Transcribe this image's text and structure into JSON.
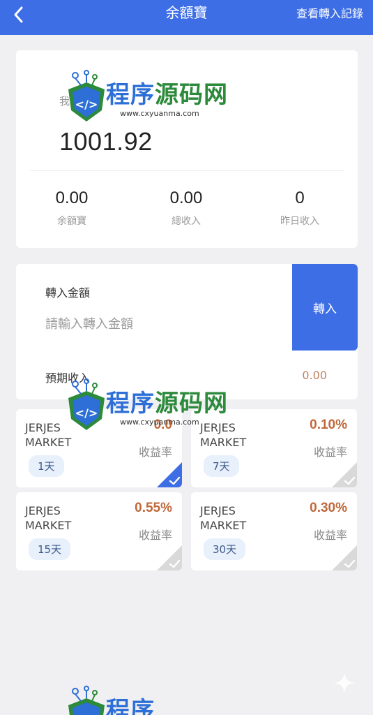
{
  "header": {
    "title": "余額寶",
    "records_label": "查看轉入記錄"
  },
  "summary": {
    "asset_label": "我的資產",
    "asset_value": "1001.92",
    "stats": [
      {
        "value": "0.00",
        "label": "余額寶"
      },
      {
        "value": "0.00",
        "label": "總收入"
      },
      {
        "value": "0",
        "label": "昨日收入"
      }
    ]
  },
  "transfer": {
    "amount_label": "轉入金額",
    "amount_placeholder": "請輸入轉入金額",
    "button_label": "轉入",
    "expected_label": "預期收入",
    "expected_value": "0.00"
  },
  "plans": [
    {
      "name": "JERJES MARKET",
      "rate": "0.0",
      "rate_label": "收益率",
      "days": "1天",
      "selected": true
    },
    {
      "name": "JERJES MARKET",
      "rate": "0.10%",
      "rate_label": "收益率",
      "days": "7天",
      "selected": false
    },
    {
      "name": "JERJES MARKET",
      "rate": "0.55%",
      "rate_label": "收益率",
      "days": "15天",
      "selected": false
    },
    {
      "name": "JERJES MARKET",
      "rate": "0.30%",
      "rate_label": "收益率",
      "days": "30天",
      "selected": false
    }
  ],
  "watermark": {
    "text_blue": "程序",
    "text_green": "源码网",
    "url": "www.cxyuanma.com"
  },
  "colors": {
    "brand": "#3d6ee6",
    "rate": "#c0673a",
    "background": "#f0f0f2"
  },
  "icons": {
    "back": "chevron-left-icon",
    "check": "check-icon",
    "sparkle": "sparkle-icon"
  }
}
